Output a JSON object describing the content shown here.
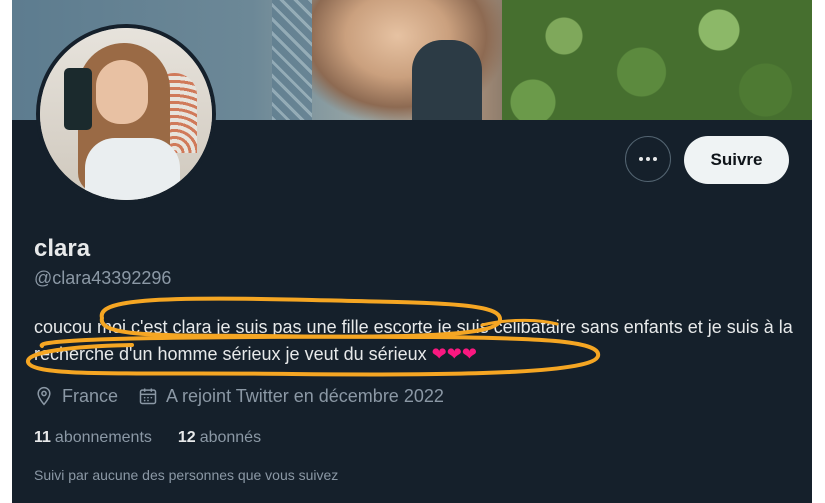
{
  "profile": {
    "display_name": "clara",
    "handle": "@clara43392296",
    "bio_text": "coucou moi c'est clara je suis pas une fille escorte je suis célibataire sans enfants et je suis à la recherche d'un homme sérieux je veut du sérieux",
    "bio_hearts": "❤❤❤",
    "location": "France",
    "joined": "A rejoint Twitter en décembre 2022",
    "following_count": "11",
    "following_label": "abonnements",
    "followers_count": "12",
    "followers_label": "abonnés",
    "followed_by_text": "Suivi par aucune des personnes que vous suivez"
  },
  "actions": {
    "more_icon": "more-horizontal-icon",
    "follow_label": "Suivre"
  },
  "icons": {
    "location": "location-pin-icon",
    "joined": "calendar-icon"
  },
  "colors": {
    "background": "#15202b",
    "text_primary": "#e7e9ea",
    "text_secondary": "#8b98a5",
    "annotation": "#f5a623",
    "heart": "#f91880"
  }
}
